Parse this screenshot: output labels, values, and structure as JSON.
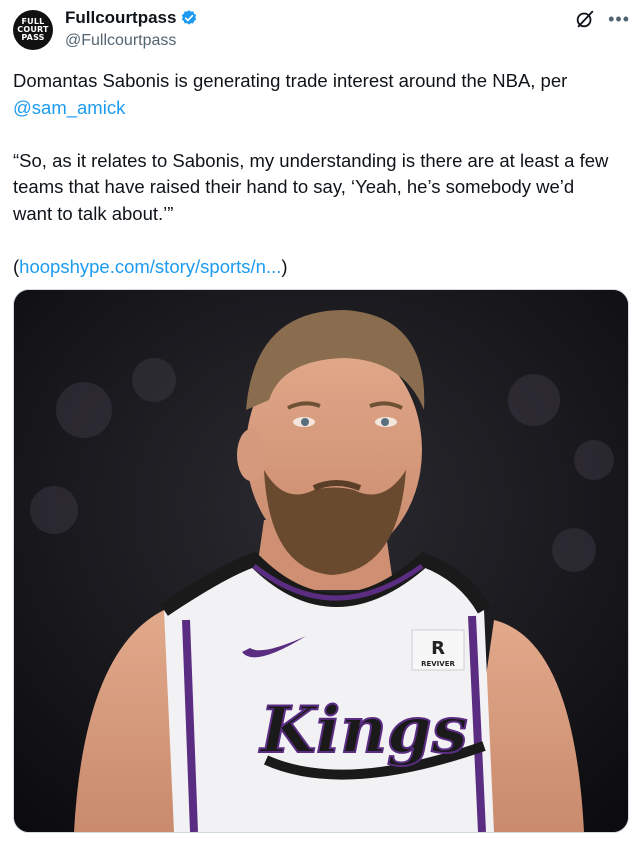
{
  "account": {
    "avatar_lines": [
      "FULL",
      "COURT",
      "PASS"
    ],
    "name": "Fullcourtpass",
    "handle": "@Fullcourtpass",
    "verified_icon": "verified-badge-icon"
  },
  "tweet": {
    "line1": "Domantas Sabonis is generating trade interest around the NBA, per",
    "mention": "@sam_amick",
    "quote_line1": "“So, as it relates to Sabonis, my understanding is there are at least a few",
    "quote_line2": "teams that have raised their hand to say, ‘Yeah, he’s somebody we’d",
    "quote_line3": "want to talk about.’”",
    "link_open": "(",
    "link_text": "hoopshype.com/story/sports/n...",
    "link_close": ")"
  },
  "media": {
    "jersey_wordmark": "Kings",
    "patch_text": "REVIVER"
  },
  "colors": {
    "link": "#1d9bf0",
    "verified": "#1d9bf0",
    "muted": "#536471",
    "jersey_trim": "#5a2d82"
  }
}
